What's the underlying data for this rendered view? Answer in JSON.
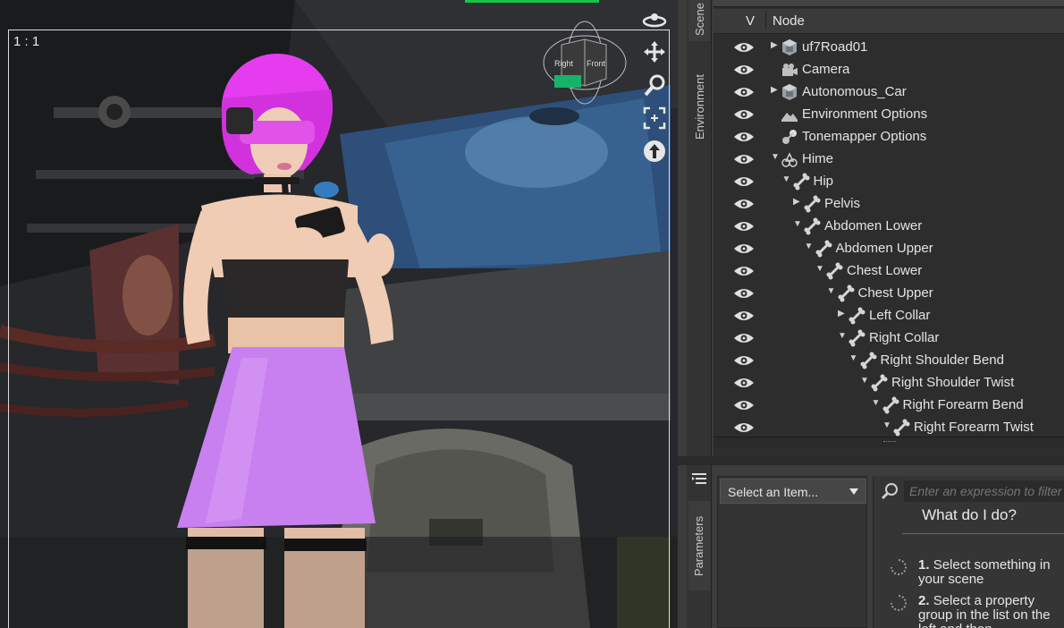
{
  "viewport": {
    "ratio_label": "1 : 1",
    "cube_faces": [
      "Right",
      "Front"
    ],
    "tools": [
      {
        "name": "orbit-icon"
      },
      {
        "name": "pan-icon"
      },
      {
        "name": "zoom-icon"
      },
      {
        "name": "frame-icon"
      },
      {
        "name": "reset-view-icon"
      }
    ]
  },
  "vertical_tabs": [
    "Scene",
    "Environment",
    "Parameters"
  ],
  "scene": {
    "header": {
      "v": "V",
      "node": "Node"
    },
    "nodes": [
      {
        "label": "uf7Road01",
        "icon": "figure-box-icon",
        "depth": 0,
        "arrow": "collapsed"
      },
      {
        "label": "Camera",
        "icon": "camera-icon",
        "depth": 0,
        "arrow": "none"
      },
      {
        "label": "Autonomous_Car",
        "icon": "figure-box-icon",
        "depth": 0,
        "arrow": "collapsed"
      },
      {
        "label": "Environment Options",
        "icon": "environment-icon",
        "depth": 0,
        "arrow": "none"
      },
      {
        "label": "Tonemapper Options",
        "icon": "tonemapper-icon",
        "depth": 0,
        "arrow": "none"
      },
      {
        "label": "Hime",
        "icon": "figure-icon",
        "depth": 0,
        "arrow": "expanded"
      },
      {
        "label": "Hip",
        "icon": "bone-icon",
        "depth": 1,
        "arrow": "expanded"
      },
      {
        "label": "Pelvis",
        "icon": "bone-icon",
        "depth": 2,
        "arrow": "collapsed"
      },
      {
        "label": "Abdomen Lower",
        "icon": "bone-icon",
        "depth": 2,
        "arrow": "expanded"
      },
      {
        "label": "Abdomen Upper",
        "icon": "bone-icon",
        "depth": 3,
        "arrow": "expanded"
      },
      {
        "label": "Chest Lower",
        "icon": "bone-icon",
        "depth": 4,
        "arrow": "expanded"
      },
      {
        "label": "Chest Upper",
        "icon": "bone-icon",
        "depth": 5,
        "arrow": "expanded"
      },
      {
        "label": "Left Collar",
        "icon": "bone-icon",
        "depth": 6,
        "arrow": "collapsed"
      },
      {
        "label": "Right Collar",
        "icon": "bone-icon",
        "depth": 6,
        "arrow": "expanded"
      },
      {
        "label": "Right Shoulder Bend",
        "icon": "bone-icon",
        "depth": 7,
        "arrow": "expanded"
      },
      {
        "label": "Right Shoulder Twist",
        "icon": "bone-icon",
        "depth": 8,
        "arrow": "expanded"
      },
      {
        "label": "Right Forearm Bend",
        "icon": "bone-icon",
        "depth": 9,
        "arrow": "expanded"
      },
      {
        "label": "Right Forearm Twist",
        "icon": "bone-icon",
        "depth": 10,
        "arrow": "expanded"
      }
    ]
  },
  "parameters": {
    "select_value": "Select an Item...",
    "filter_placeholder": "Enter an expression to filter",
    "help_title": "What do I do?",
    "steps": [
      {
        "num": "1.",
        "text": "Select something in your scene"
      },
      {
        "num": "2.",
        "text": "Select a property group in the list on the left and then"
      }
    ]
  },
  "colors": {
    "accent_green": "#19c34a",
    "panel_bg": "#2d2d2d",
    "hair": "#e53cf0",
    "skirt": "#c87ff0"
  }
}
